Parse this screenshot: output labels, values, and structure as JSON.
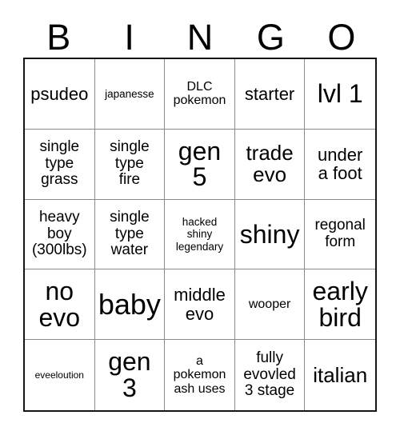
{
  "card": {
    "header_letters": [
      "B",
      "I",
      "N",
      "G",
      "O"
    ],
    "rows": [
      [
        {
          "text": "psudeo",
          "size": "l"
        },
        {
          "text": "japanesse",
          "size": "xs"
        },
        {
          "text": "DLC\npokemon",
          "size": "s"
        },
        {
          "text": "starter",
          "size": "l"
        },
        {
          "text": "lvl 1",
          "size": "xxl"
        }
      ],
      [
        {
          "text": "single\ntype\ngrass",
          "size": "m"
        },
        {
          "text": "single\ntype\nfire",
          "size": "m"
        },
        {
          "text": "gen\n5",
          "size": "xxl"
        },
        {
          "text": "trade\nevo",
          "size": "xl"
        },
        {
          "text": "under\na foot",
          "size": "l"
        }
      ],
      [
        {
          "text": "heavy\nboy\n(300lbs)",
          "size": "m"
        },
        {
          "text": "single\ntype\nwater",
          "size": "m"
        },
        {
          "text": "hacked\nshiny\nlegendary",
          "size": "xs"
        },
        {
          "text": "shiny",
          "size": "xxl"
        },
        {
          "text": "regonal\nform",
          "size": "m"
        }
      ],
      [
        {
          "text": "no\nevo",
          "size": "xxl"
        },
        {
          "text": "baby",
          "size": "3xl"
        },
        {
          "text": "middle\nevo",
          "size": "l"
        },
        {
          "text": "wooper",
          "size": "s"
        },
        {
          "text": "early\nbird",
          "size": "xxl"
        }
      ],
      [
        {
          "text": "eveeloution",
          "size": "xxs"
        },
        {
          "text": "gen\n3",
          "size": "xxl"
        },
        {
          "text": "a\npokemon\nash uses",
          "size": "s"
        },
        {
          "text": "fully\nevovled\n3 stage",
          "size": "m"
        },
        {
          "text": "italian",
          "size": "xl"
        }
      ]
    ]
  },
  "colors": {
    "background": "#ffffff",
    "text": "#000000",
    "grid_line": "#8a8a8a",
    "outer_border": "#141414"
  }
}
